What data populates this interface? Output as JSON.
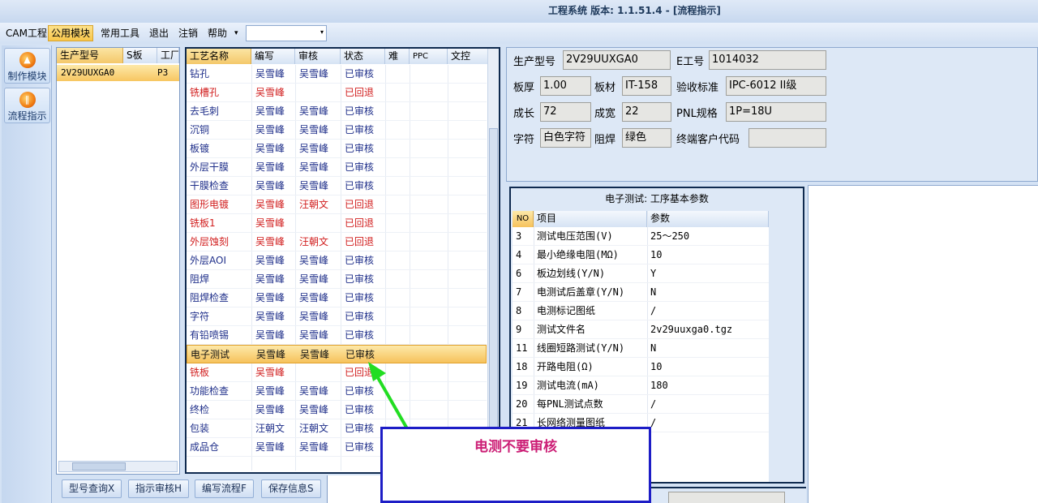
{
  "window_title": "工程系统  版本: 1.1.51.4 - [流程指示]",
  "menu": {
    "items": [
      "CAM工程",
      "公用模块",
      "常用工具",
      "退出",
      "注销",
      "帮助"
    ],
    "combo_arrow": "▾"
  },
  "nav": {
    "make_module": "制作模块",
    "flow_indicator": "流程指示",
    "make_icon": "fire-icon",
    "flow_icon": "flow-icon"
  },
  "model_grid": {
    "headers": [
      "生产型号",
      "S板",
      "工厂"
    ],
    "row": {
      "model": "2V29UUXGA0",
      "factory": "P3"
    }
  },
  "flow_grid": {
    "headers": [
      "工艺名称",
      "编写",
      "审核",
      "状态",
      "难",
      "PPC",
      "文控"
    ],
    "rows": [
      {
        "name": "钻孔",
        "writer": "吴雪峰",
        "reviewer": "吴雪峰",
        "status": "已审核",
        "tone": "ok"
      },
      {
        "name": "铣槽孔",
        "writer": "吴雪峰",
        "reviewer": "",
        "status": "已回退",
        "tone": "back"
      },
      {
        "name": "去毛刺",
        "writer": "吴雪峰",
        "reviewer": "吴雪峰",
        "status": "已审核",
        "tone": "ok"
      },
      {
        "name": "沉铜",
        "writer": "吴雪峰",
        "reviewer": "吴雪峰",
        "status": "已审核",
        "tone": "ok"
      },
      {
        "name": "板镀",
        "writer": "吴雪峰",
        "reviewer": "吴雪峰",
        "status": "已审核",
        "tone": "ok"
      },
      {
        "name": "外层干膜",
        "writer": "吴雪峰",
        "reviewer": "吴雪峰",
        "status": "已审核",
        "tone": "ok"
      },
      {
        "name": "干膜检查",
        "writer": "吴雪峰",
        "reviewer": "吴雪峰",
        "status": "已审核",
        "tone": "ok"
      },
      {
        "name": "图形电镀",
        "writer": "吴雪峰",
        "reviewer": "汪朝文",
        "status": "已回退",
        "tone": "back"
      },
      {
        "name": "铣板1",
        "writer": "吴雪峰",
        "reviewer": "",
        "status": "已回退",
        "tone": "back"
      },
      {
        "name": "外层蚀刻",
        "writer": "吴雪峰",
        "reviewer": "汪朝文",
        "status": "已回退",
        "tone": "back"
      },
      {
        "name": "外层AOI",
        "writer": "吴雪峰",
        "reviewer": "吴雪峰",
        "status": "已审核",
        "tone": "ok"
      },
      {
        "name": "阻焊",
        "writer": "吴雪峰",
        "reviewer": "吴雪峰",
        "status": "已审核",
        "tone": "ok"
      },
      {
        "name": "阻焊检查",
        "writer": "吴雪峰",
        "reviewer": "吴雪峰",
        "status": "已审核",
        "tone": "ok"
      },
      {
        "name": "字符",
        "writer": "吴雪峰",
        "reviewer": "吴雪峰",
        "status": "已审核",
        "tone": "ok"
      },
      {
        "name": "有铅喷锡",
        "writer": "吴雪峰",
        "reviewer": "吴雪峰",
        "status": "已审核",
        "tone": "ok"
      },
      {
        "name": "电子测试",
        "writer": "吴雪峰",
        "reviewer": "吴雪峰",
        "status": "已审核",
        "tone": "sel"
      },
      {
        "name": "铣板",
        "writer": "吴雪峰",
        "reviewer": "",
        "status": "已回退",
        "tone": "back"
      },
      {
        "name": "功能检查",
        "writer": "吴雪峰",
        "reviewer": "吴雪峰",
        "status": "已审核",
        "tone": "ok"
      },
      {
        "name": "终检",
        "writer": "吴雪峰",
        "reviewer": "吴雪峰",
        "status": "已审核",
        "tone": "ok"
      },
      {
        "name": "包装",
        "writer": "汪朝文",
        "reviewer": "汪朝文",
        "status": "已审核",
        "tone": "ok"
      },
      {
        "name": "成品仓",
        "writer": "吴雪峰",
        "reviewer": "吴雪峰",
        "status": "已审核",
        "tone": "ok"
      }
    ]
  },
  "toolbar": {
    "query": "型号查询X",
    "review": "指示审核H",
    "write": "编写流程F",
    "save": "保存信息S"
  },
  "info": {
    "model_label": "生产型号",
    "model_value": "2V29UUXGA0",
    "eno_label": "E工号",
    "eno_value": "1014032",
    "thick_label": "板厚",
    "thick_value": "1.00",
    "mat_label": "板材",
    "mat_value": "IT-158",
    "std_label": "验收标准",
    "std_value": "IPC-6012 II级",
    "len_label": "成长",
    "len_value": "72",
    "wid_label": "成宽",
    "wid_value": "22",
    "pnl_label": "PNL规格",
    "pnl_value": "1P=18U",
    "char_label": "字符",
    "char_value": "白色字符",
    "mask_label": "阻焊",
    "mask_value": "绿色",
    "cust_label": "终端客户代码",
    "cust_value": ""
  },
  "params": {
    "title": "电子测试: 工序基本参数",
    "headers": {
      "no": "NO",
      "item": "项目",
      "value": "参数"
    },
    "rows": [
      {
        "no": "3",
        "item": "测试电压范围(V)",
        "value": "25～250"
      },
      {
        "no": "4",
        "item": "最小绝缘电阻(MΩ)",
        "value": "10"
      },
      {
        "no": "6",
        "item": "板边划线(Y/N)",
        "value": "Y"
      },
      {
        "no": "7",
        "item": "电测试后盖章(Y/N)",
        "value": "N"
      },
      {
        "no": "8",
        "item": "电测标记图纸",
        "value": "/"
      },
      {
        "no": "9",
        "item": "测试文件名",
        "value": "2v29uuxga0.tgz"
      },
      {
        "no": "11",
        "item": "线圈短路测试(Y/N)",
        "value": "N"
      },
      {
        "no": "18",
        "item": "开路电阻(Ω)",
        "value": "10"
      },
      {
        "no": "19",
        "item": "测试电流(mA)",
        "value": "180"
      },
      {
        "no": "20",
        "item": "每PNL测试点数",
        "value": "/"
      },
      {
        "no": "21",
        "item": "长网络测量图纸",
        "value": "/"
      }
    ]
  },
  "callout": {
    "text": "电测不要审核",
    "color": "#cc1f76"
  },
  "colors": {
    "ok": "#1f2f8a",
    "back": "#d11e1e",
    "accent": "#f6c25c",
    "arrow": "#22dd22"
  }
}
